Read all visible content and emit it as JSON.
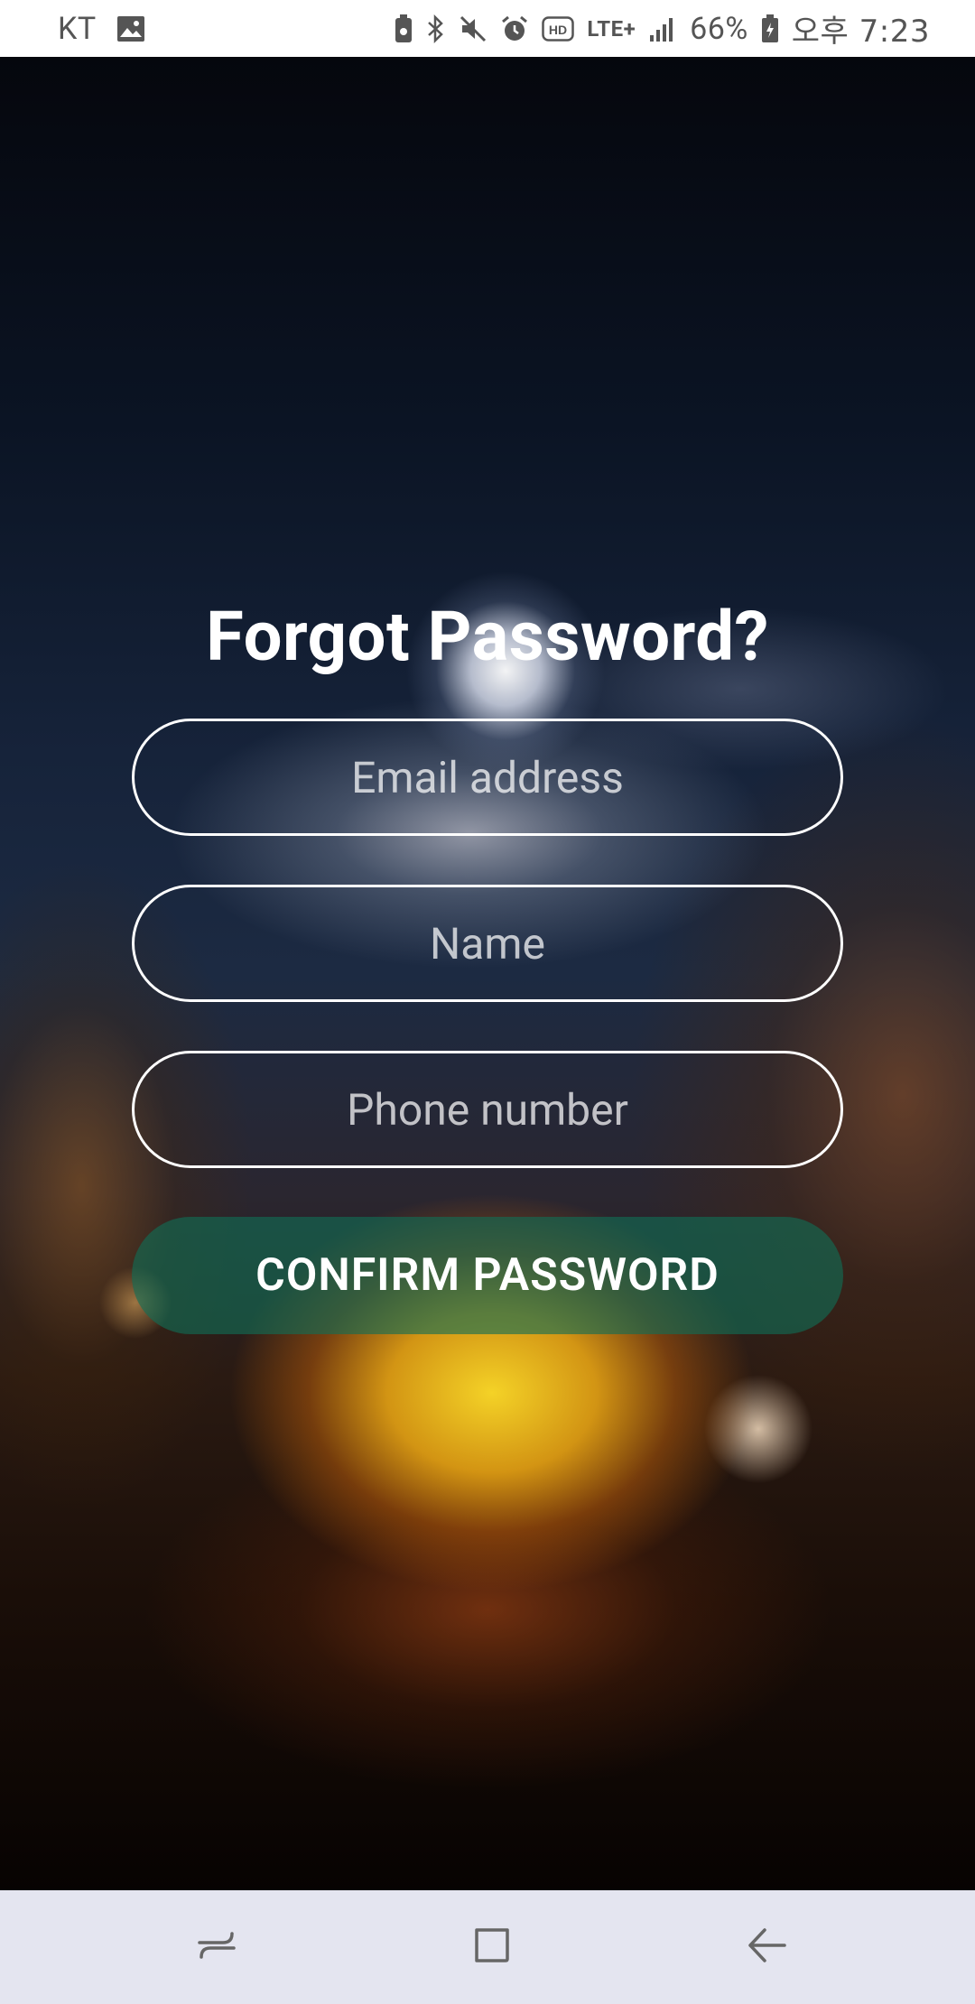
{
  "status_bar": {
    "carrier": "KT",
    "network": "LTE+",
    "battery": "66%",
    "time": "오후 7:23",
    "icons": [
      "image-icon",
      "battery-saver-icon",
      "bluetooth-icon",
      "mute-icon",
      "alarm-icon",
      "hd-icon",
      "signal-icon",
      "battery-icon"
    ]
  },
  "form": {
    "title": "Forgot Password?",
    "email_placeholder": "Email address",
    "name_placeholder": "Name",
    "phone_placeholder": "Phone number",
    "confirm_label": "CONFIRM PASSWORD"
  },
  "nav_bar": {
    "icons": [
      "recent-apps-icon",
      "home-icon",
      "back-icon"
    ]
  },
  "colors": {
    "button_bg": "#106e56",
    "nav_bg": "#e4e5f0",
    "caret": "#2ec4b6"
  }
}
